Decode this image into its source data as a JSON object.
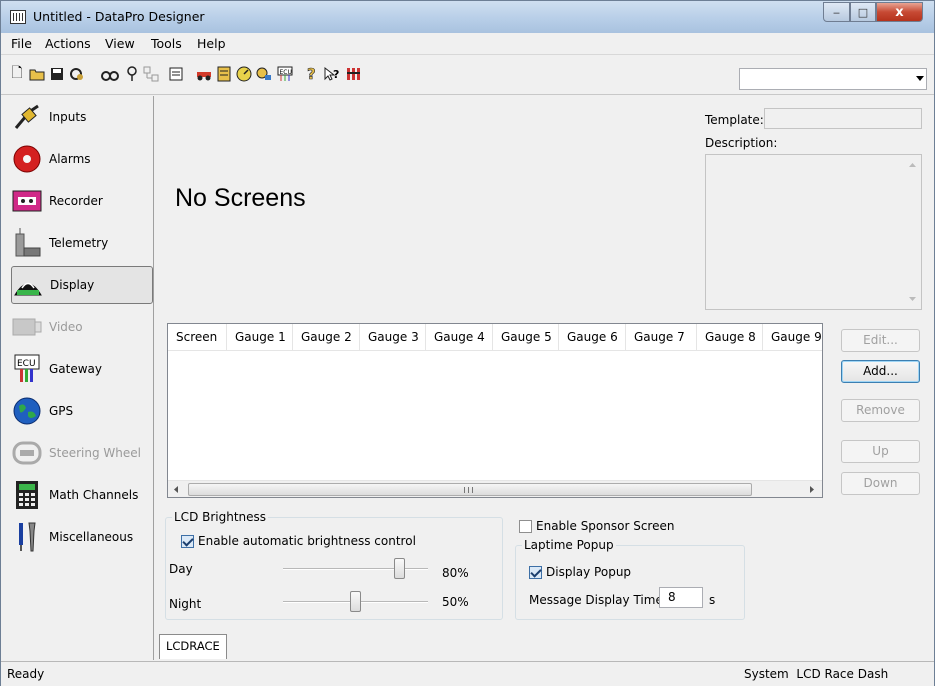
{
  "window": {
    "title": "Untitled - DataPro Designer",
    "minimize": "‒",
    "maximize": "□",
    "close": "x"
  },
  "menu": [
    "File",
    "Actions",
    "View",
    "Tools",
    "Help"
  ],
  "toolbar": {
    "icons": [
      "new-file-icon",
      "open-folder-icon",
      "save-icon",
      "print-icon",
      "binoculars-icon",
      "probe-icon",
      "network-icon",
      "properties-icon",
      "race-car-icon",
      "notes-icon",
      "gauge-icon",
      "wrench-icon",
      "ecu-icon",
      "help-icon",
      "whats-this-icon",
      "columns-icon"
    ],
    "combo_value": ""
  },
  "sidebar": [
    {
      "label": "Inputs",
      "icon": "plug-icon",
      "state": "normal"
    },
    {
      "label": "Alarms",
      "icon": "alarm-bell-icon",
      "state": "normal"
    },
    {
      "label": "Recorder",
      "icon": "cassette-icon",
      "state": "normal"
    },
    {
      "label": "Telemetry",
      "icon": "antenna-icon",
      "state": "normal"
    },
    {
      "label": "Display",
      "icon": "display-dash-icon",
      "state": "selected"
    },
    {
      "label": "Video",
      "icon": "video-camera-icon",
      "state": "disabled"
    },
    {
      "label": "Gateway",
      "icon": "ecu-cable-icon",
      "state": "normal"
    },
    {
      "label": "GPS",
      "icon": "globe-icon",
      "state": "normal"
    },
    {
      "label": "Steering Wheel",
      "icon": "steering-wheel-icon",
      "state": "disabled"
    },
    {
      "label": "Math Channels",
      "icon": "calculator-icon",
      "state": "normal"
    },
    {
      "label": "Miscellaneous",
      "icon": "tools-icon",
      "state": "normal"
    }
  ],
  "main": {
    "heading": "No Screens",
    "template_label": "Template:",
    "template_value": "",
    "description_label": "Description:",
    "description_value": "",
    "columns": [
      "Screen",
      "Gauge 1",
      "Gauge 2",
      "Gauge 3",
      "Gauge 4",
      "Gauge 5",
      "Gauge 6",
      "Gauge 7",
      "Gauge 8",
      "Gauge 9"
    ],
    "buttons": {
      "edit": "Edit...",
      "add": "Add...",
      "remove": "Remove",
      "up": "Up",
      "down": "Down"
    },
    "lcd_brightness": {
      "title": "LCD Brightness",
      "auto_label": "Enable automatic brightness control",
      "auto_checked": true,
      "day_label": "Day",
      "day_value": "80%",
      "day_level": 0.8,
      "night_label": "Night",
      "night_value": "50%",
      "night_level": 0.5
    },
    "sponsor": {
      "label": "Enable Sponsor Screen",
      "checked": false
    },
    "laptime": {
      "title": "Laptime Popup",
      "display_label": "Display Popup",
      "display_checked": true,
      "msg_label": "Message Display Time:",
      "msg_value": "8",
      "msg_unit": "s"
    },
    "tab": "LCDRACE"
  },
  "status": {
    "left": "Ready",
    "right": "System  LCD Race Dash"
  }
}
